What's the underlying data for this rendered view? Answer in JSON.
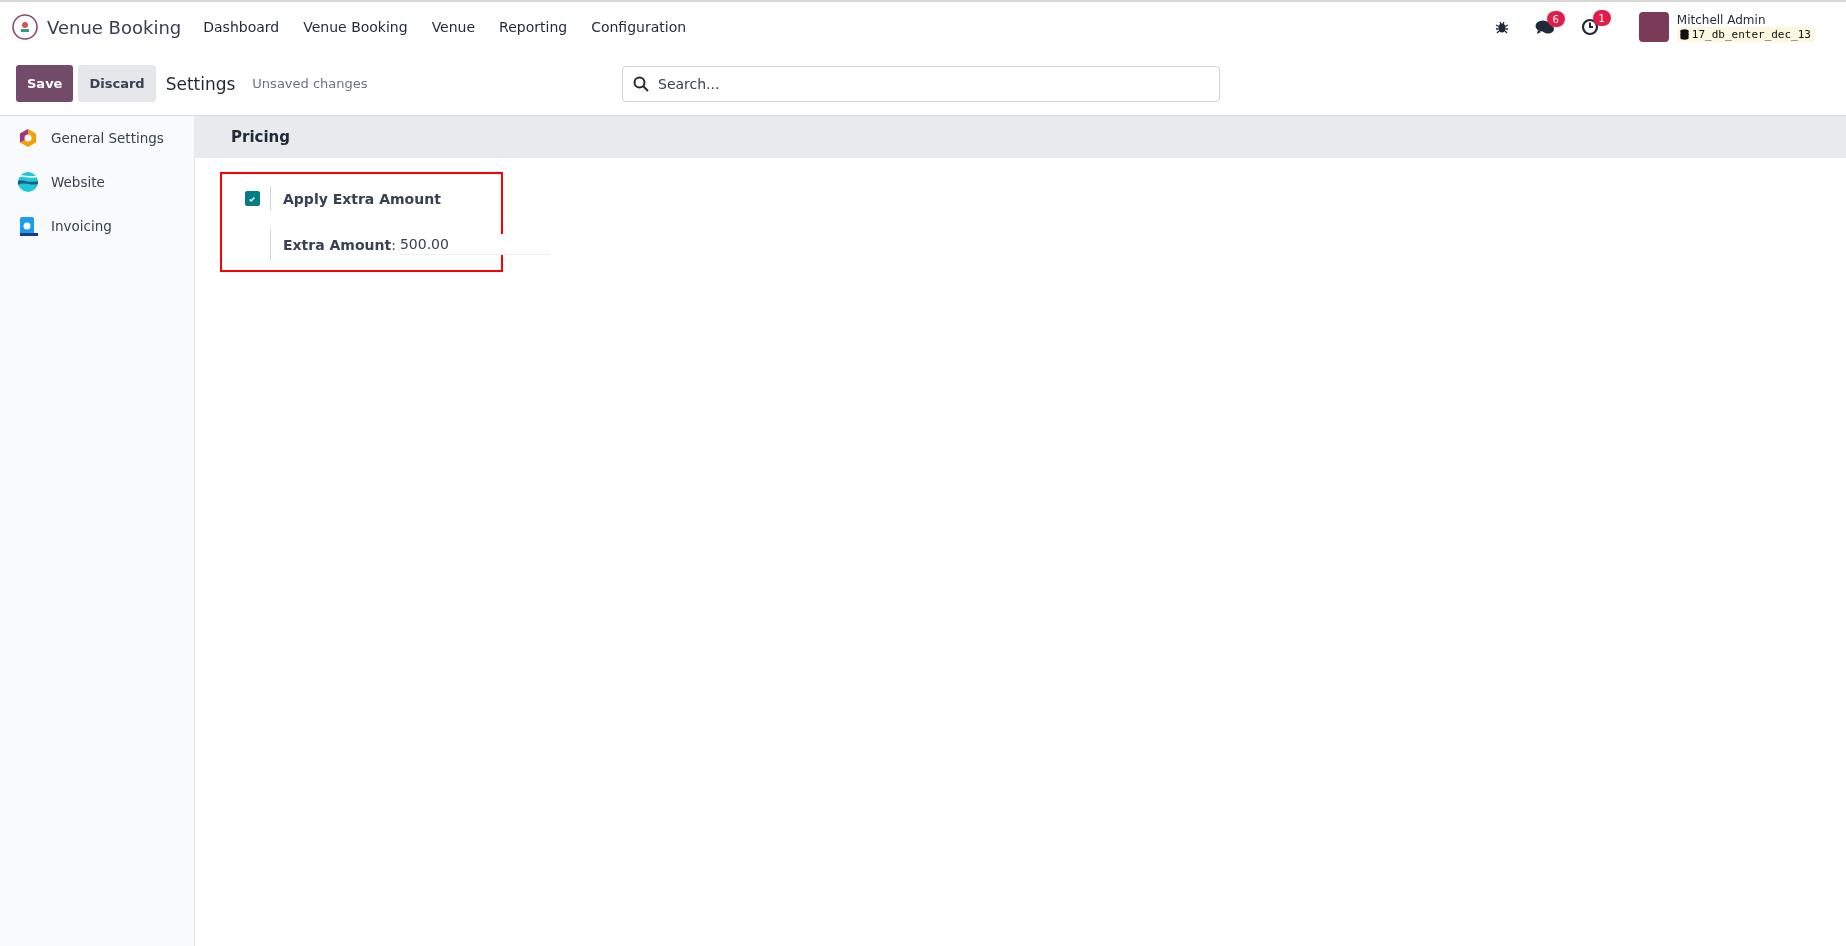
{
  "app": {
    "name": "Venue Booking"
  },
  "menu": [
    "Dashboard",
    "Venue Booking",
    "Venue",
    "Reporting",
    "Configuration"
  ],
  "systray": {
    "messages_count": "6",
    "activities_count": "1",
    "user": "Mitchell Admin",
    "database": "17_db_enter_dec_13"
  },
  "control_bar": {
    "buttons": [
      {
        "label": "Save",
        "kind": "primary"
      },
      {
        "label": "Discard",
        "kind": "secondary"
      }
    ],
    "title": "Settings",
    "status": "Unsaved changes",
    "search": {
      "placeholder": "Search..."
    }
  },
  "sidebar": {
    "items": [
      {
        "label": "General Settings",
        "selected": false
      },
      {
        "label": "Website",
        "selected": false
      },
      {
        "label": "Invoicing",
        "selected": false
      }
    ]
  },
  "section": {
    "title": "Pricing",
    "setting": {
      "label": "Apply Extra Amount",
      "checked": true,
      "field_label": "Extra Amount",
      "field_separator": ":",
      "field_value": "500.00"
    }
  }
}
